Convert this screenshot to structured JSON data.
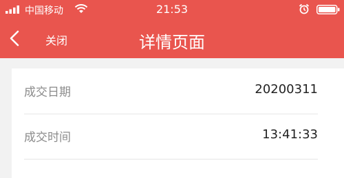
{
  "status_bar": {
    "carrier": "中国移动",
    "time": "21:53"
  },
  "nav": {
    "close_label": "关闭",
    "title": "详情页面"
  },
  "details": [
    {
      "label": "成交日期",
      "value": "20200311"
    },
    {
      "label": "成交时间",
      "value": "13:41:33"
    }
  ],
  "colors": {
    "header": "#e9554e",
    "background": "#f2f2f2",
    "label": "#8c8c8c",
    "value": "#222222"
  },
  "icons": [
    "signal-icon",
    "wifi-icon",
    "alarm-icon",
    "battery-icon",
    "back-arrow-icon"
  ]
}
